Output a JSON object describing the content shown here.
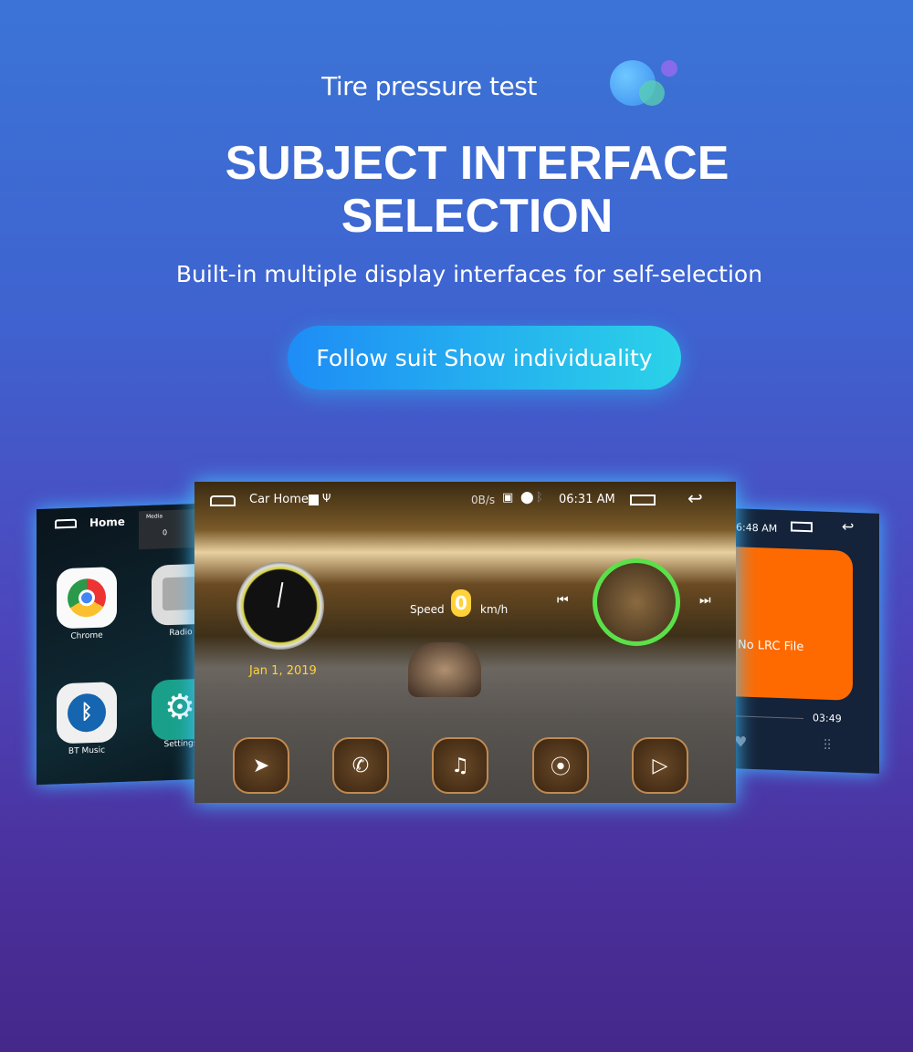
{
  "header": {
    "brand": "Tire pressure test",
    "title_line1": "SUBJECT INTERFACE",
    "title_line2": "SELECTION",
    "subtitle": "Built-in multiple display interfaces for self-selection",
    "button": "Follow suit Show individuality"
  },
  "left_screen": {
    "title": "Home",
    "media_label": "Media",
    "media_count": "0",
    "apps": [
      {
        "label": "Chrome",
        "icon": "chrome-icon"
      },
      {
        "label": "Radio",
        "icon": "radio-icon"
      },
      {
        "label": "BT Music",
        "icon": "bluetooth-icon"
      },
      {
        "label": "Settings",
        "icon": "gear-icon"
      }
    ]
  },
  "center_screen": {
    "app_title": "Car Home",
    "net_speed": "0B/s",
    "time": "06:31 AM",
    "date": "Jan 1, 2019",
    "speed_label": "Speed",
    "speed_value": "0",
    "speed_unit": "km/h",
    "dock": [
      "navigation-icon",
      "phone-icon",
      "music-icon",
      "radio-icon",
      "video-icon"
    ]
  },
  "right_screen": {
    "time": "6:48 AM",
    "lyrics": "No LRC File",
    "duration": "03:49"
  },
  "colors": {
    "accent": "#2bd2e8",
    "date": "#ffd23a",
    "album_ring": "#5be04a",
    "lyrics_panel": "#ff6a00"
  }
}
